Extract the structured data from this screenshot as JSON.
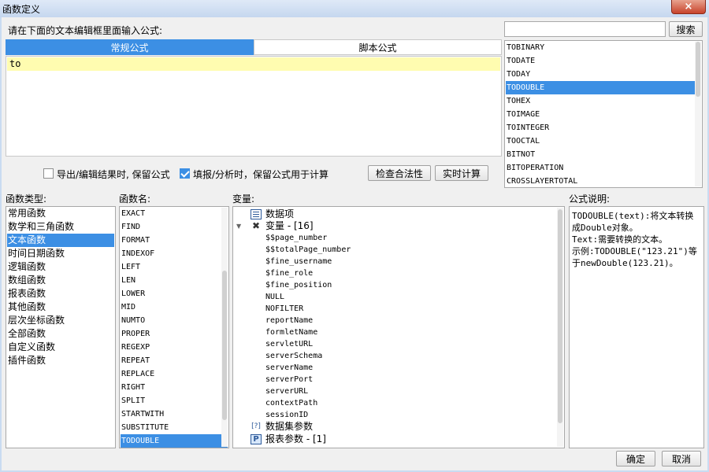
{
  "window": {
    "title": "函数定义",
    "close_label": "×"
  },
  "formula": {
    "instruction": "请在下面的文本编辑框里面输入公式:",
    "tabs": [
      {
        "label": "常规公式",
        "active": true
      },
      {
        "label": "脚本公式",
        "active": false
      }
    ],
    "editor_text": "to"
  },
  "search": {
    "input_value": "",
    "button_label": "搜索"
  },
  "search_results": {
    "items": [
      "TOBINARY",
      "TODATE",
      "TODAY",
      "TODOUBLE",
      "TOHEX",
      "TOIMAGE",
      "TOINTEGER",
      "TOOCTAL",
      "BITNOT",
      "BITOPERATION",
      "CROSSLAYERTOTAL"
    ],
    "selected": "TODOUBLE"
  },
  "options": {
    "export_keep_formula": {
      "label": "导出/编辑结果时, 保留公式",
      "checked": false
    },
    "fill_keep_formula": {
      "label": "填报/分析时，保留公式用于计算",
      "checked": true
    },
    "check_button": "检查合法性",
    "realtime_button": "实时计算"
  },
  "function_types": {
    "header": "函数类型:",
    "items": [
      "常用函数",
      "数学和三角函数",
      "文本函数",
      "时间日期函数",
      "逻辑函数",
      "数组函数",
      "报表函数",
      "其他函数",
      "层次坐标函数",
      "全部函数",
      "自定义函数",
      "插件函数"
    ],
    "selected": "文本函数"
  },
  "function_names": {
    "header": "函数名:",
    "items": [
      "EXACT",
      "FIND",
      "FORMAT",
      "INDEXOF",
      "LEFT",
      "LEN",
      "LOWER",
      "MID",
      "NUMTO",
      "PROPER",
      "REGEXP",
      "REPEAT",
      "REPLACE",
      "RIGHT",
      "SPLIT",
      "STARTWITH",
      "SUBSTITUTE",
      "TODOUBLE"
    ],
    "selected": "TODOUBLE"
  },
  "variables": {
    "header": "变量:",
    "data_items_label": "数据项",
    "vars_label": "变量 - [16]",
    "vars_expanded_glyph": "▼",
    "var_items": [
      "$$page_number",
      "$$totalPage_number",
      "$fine_username",
      "$fine_role",
      "$fine_position",
      "NULL",
      "NOFILTER",
      "reportName",
      "formletName",
      "servletURL",
      "serverSchema",
      "serverName",
      "serverPort",
      "serverURL",
      "contextPath",
      "sessionID"
    ],
    "dataset_params_label": "数据集参数",
    "report_params_label": "报表参数 - [1]",
    "report_params_icon_text": "P",
    "dataset_icon_text": "[?]"
  },
  "description": {
    "header": "公式说明:",
    "text_lines": [
      "TODOUBLE(text):将文本转换",
      "成Double对象。",
      "Text:需要转换的文本。",
      "示例:TODOUBLE(\"123.21\")等",
      "于newDouble(123.21)。"
    ]
  },
  "footer": {
    "ok_label": "确定",
    "cancel_label": "取消"
  },
  "colors": {
    "accent": "#3c8fe4",
    "editor_line_highlight": "#fffcb0",
    "window_frame": "#c9dbf1"
  }
}
